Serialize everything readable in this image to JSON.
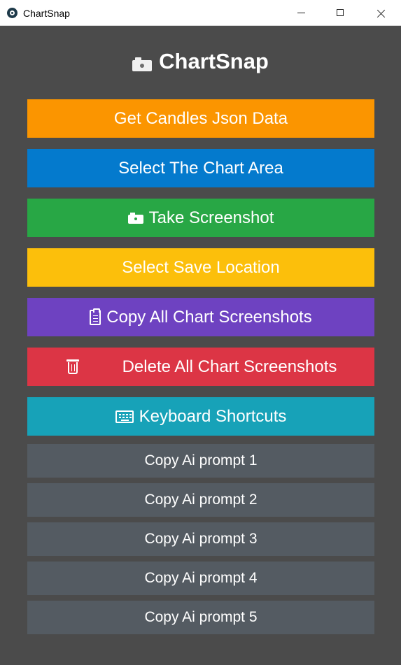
{
  "window": {
    "title": "ChartSnap",
    "controls": [
      "minimize",
      "maximize",
      "close"
    ]
  },
  "header": {
    "icon": "camera-icon",
    "title": "ChartSnap"
  },
  "buttons": {
    "get_candles": {
      "label": "Get Candles Json Data",
      "color": "#fb9500"
    },
    "select_area": {
      "label": "Select The Chart Area",
      "color": "#047acd"
    },
    "take_screenshot": {
      "label": "Take Screenshot",
      "icon": "camera-icon",
      "color": "#28a745"
    },
    "select_save": {
      "label": "Select Save Location",
      "color": "#fcbf0b"
    },
    "copy_all": {
      "label": "Copy All Chart Screenshots",
      "icon": "clipboard-icon",
      "color": "#6e42c1"
    },
    "delete_all": {
      "label": "Delete All Chart Screenshots",
      "icon": "trash-icon",
      "color": "#dc3545"
    },
    "keyboard": {
      "label": "Keyboard Shortcuts",
      "icon": "keyboard-icon",
      "color": "#17a2b8"
    }
  },
  "prompts": [
    "Copy Ai prompt 1",
    "Copy Ai prompt 2",
    "Copy Ai prompt 3",
    "Copy Ai prompt 4",
    "Copy Ai prompt 5"
  ],
  "colors": {
    "background": "#4b4b4b",
    "prompt_button": "#545b62"
  }
}
